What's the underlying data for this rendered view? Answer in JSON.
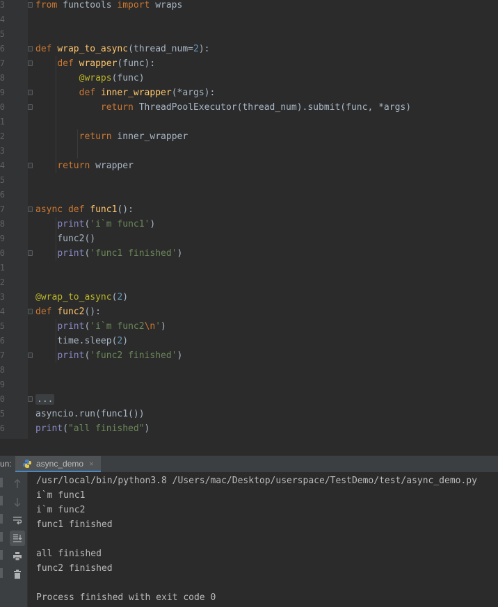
{
  "editor": {
    "lines": [
      {
        "n": "3",
        "fold": true,
        "tokens": [
          [
            "kw",
            "from"
          ],
          [
            "txt",
            " functools "
          ],
          [
            "kw",
            "import"
          ],
          [
            "txt",
            " wraps"
          ]
        ]
      },
      {
        "n": "4",
        "tokens": []
      },
      {
        "n": "5",
        "tokens": []
      },
      {
        "n": "6",
        "fold": true,
        "tokens": [
          [
            "kw",
            "def "
          ],
          [
            "fn",
            "wrap_to_async"
          ],
          [
            "txt",
            "(thread_num="
          ],
          [
            "num",
            "2"
          ],
          [
            "txt",
            "):"
          ]
        ]
      },
      {
        "n": "7",
        "fold": true,
        "tokens": [
          [
            "txt",
            "    "
          ],
          [
            "kw",
            "def "
          ],
          [
            "fn",
            "wrapper"
          ],
          [
            "txt",
            "(func):"
          ]
        ]
      },
      {
        "n": "8",
        "tokens": [
          [
            "txt",
            "        "
          ],
          [
            "dec",
            "@wraps"
          ],
          [
            "txt",
            "(func)"
          ]
        ]
      },
      {
        "n": "9",
        "fold": true,
        "tokens": [
          [
            "txt",
            "        "
          ],
          [
            "kw",
            "def "
          ],
          [
            "fn",
            "inner_wrapper"
          ],
          [
            "txt",
            "(*args):"
          ]
        ]
      },
      {
        "n": "0",
        "fold": true,
        "tokens": [
          [
            "txt",
            "            "
          ],
          [
            "kw",
            "return "
          ],
          [
            "txt",
            "ThreadPoolExecutor(thread_num).submit(func, *args)"
          ]
        ]
      },
      {
        "n": "1",
        "tokens": []
      },
      {
        "n": "2",
        "tokens": [
          [
            "txt",
            "        "
          ],
          [
            "kw",
            "return "
          ],
          [
            "txt",
            "inner_wrapper"
          ]
        ]
      },
      {
        "n": "3",
        "tokens": []
      },
      {
        "n": "4",
        "fold": true,
        "tokens": [
          [
            "txt",
            "    "
          ],
          [
            "kw",
            "return "
          ],
          [
            "txt",
            "wrapper"
          ]
        ]
      },
      {
        "n": "5",
        "tokens": []
      },
      {
        "n": "6",
        "tokens": []
      },
      {
        "n": "7",
        "fold": true,
        "tokens": [
          [
            "kw",
            "async def "
          ],
          [
            "fn",
            "func1"
          ],
          [
            "txt",
            "():"
          ]
        ]
      },
      {
        "n": "8",
        "tokens": [
          [
            "txt",
            "    "
          ],
          [
            "bi",
            "print"
          ],
          [
            "txt",
            "("
          ],
          [
            "str",
            "'i`m func1'"
          ],
          [
            "txt",
            ")"
          ]
        ]
      },
      {
        "n": "9",
        "tokens": [
          [
            "txt",
            "    func2()"
          ]
        ]
      },
      {
        "n": "0",
        "fold": true,
        "tokens": [
          [
            "txt",
            "    "
          ],
          [
            "bi",
            "print"
          ],
          [
            "txt",
            "("
          ],
          [
            "str",
            "'func1 finished'"
          ],
          [
            "txt",
            ")"
          ]
        ]
      },
      {
        "n": "1",
        "tokens": []
      },
      {
        "n": "2",
        "tokens": []
      },
      {
        "n": "3",
        "tokens": [
          [
            "dec",
            "@wrap_to_async"
          ],
          [
            "txt",
            "("
          ],
          [
            "num",
            "2"
          ],
          [
            "txt",
            ")"
          ]
        ]
      },
      {
        "n": "4",
        "fold": true,
        "tokens": [
          [
            "kw",
            "def "
          ],
          [
            "fn",
            "func2"
          ],
          [
            "txt",
            "():"
          ]
        ]
      },
      {
        "n": "5",
        "tokens": [
          [
            "txt",
            "    "
          ],
          [
            "bi",
            "print"
          ],
          [
            "txt",
            "("
          ],
          [
            "str",
            "'i`m func2"
          ],
          [
            "esc",
            "\\n"
          ],
          [
            "str",
            "'"
          ],
          [
            "txt",
            ")"
          ]
        ]
      },
      {
        "n": "6",
        "tokens": [
          [
            "txt",
            "    time.sleep("
          ],
          [
            "num",
            "2"
          ],
          [
            "txt",
            ")"
          ]
        ]
      },
      {
        "n": "7",
        "fold": true,
        "tokens": [
          [
            "txt",
            "    "
          ],
          [
            "bi",
            "print"
          ],
          [
            "txt",
            "("
          ],
          [
            "str",
            "'func2 finished'"
          ],
          [
            "txt",
            ")"
          ]
        ]
      },
      {
        "n": "8",
        "tokens": []
      },
      {
        "n": "9",
        "tokens": []
      },
      {
        "n": "0",
        "fold": true,
        "tokens": [
          [
            "folded",
            "..."
          ]
        ]
      },
      {
        "n": "5",
        "tokens": [
          [
            "txt",
            "asyncio.run(func1())"
          ]
        ]
      },
      {
        "n": "6",
        "tokens": [
          [
            "bi",
            "print"
          ],
          [
            "txt",
            "("
          ],
          [
            "str",
            "\"all finished\""
          ],
          [
            "txt",
            ")"
          ]
        ]
      }
    ]
  },
  "run_panel": {
    "label": "un:",
    "tab_label": "async_demo",
    "tab_close": "×",
    "console_lines": [
      "/usr/local/bin/python3.8 /Users/mac/Desktop/userspace/TestDemo/test/async_demo.py",
      "i`m func1",
      "i`m func2",
      "func1 finished",
      "",
      "all finished",
      "func2 finished",
      "",
      "Process finished with exit code 0"
    ]
  }
}
